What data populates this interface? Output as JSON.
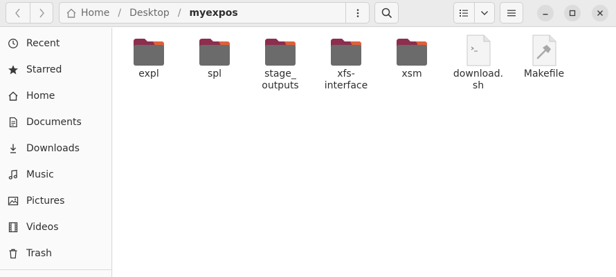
{
  "path": {
    "crumbs": [
      "Home",
      "Desktop",
      "myexpos"
    ],
    "separator": "/"
  },
  "sidebar": {
    "items": [
      {
        "label": "Recent",
        "icon": "clock-icon"
      },
      {
        "label": "Starred",
        "icon": "star-icon"
      },
      {
        "label": "Home",
        "icon": "home-icon"
      },
      {
        "label": "Documents",
        "icon": "document-icon"
      },
      {
        "label": "Downloads",
        "icon": "download-icon"
      },
      {
        "label": "Music",
        "icon": "music-icon"
      },
      {
        "label": "Pictures",
        "icon": "picture-icon"
      },
      {
        "label": "Videos",
        "icon": "film-icon"
      },
      {
        "label": "Trash",
        "icon": "trash-icon"
      }
    ]
  },
  "files": [
    {
      "name": "expl",
      "type": "folder"
    },
    {
      "name": "spl",
      "type": "folder"
    },
    {
      "name": "stage_\noutputs",
      "type": "folder"
    },
    {
      "name": "xfs-\ninterface",
      "type": "folder"
    },
    {
      "name": "xsm",
      "type": "folder"
    },
    {
      "name": "download.\nsh",
      "type": "script"
    },
    {
      "name": "Makefile",
      "type": "makefile"
    }
  ],
  "colors": {
    "folder_body": "#6b6b6b",
    "folder_tab": "#8d2e4f",
    "folder_tab_accent": "#e0603a",
    "headerbar": "#ebebeb"
  }
}
